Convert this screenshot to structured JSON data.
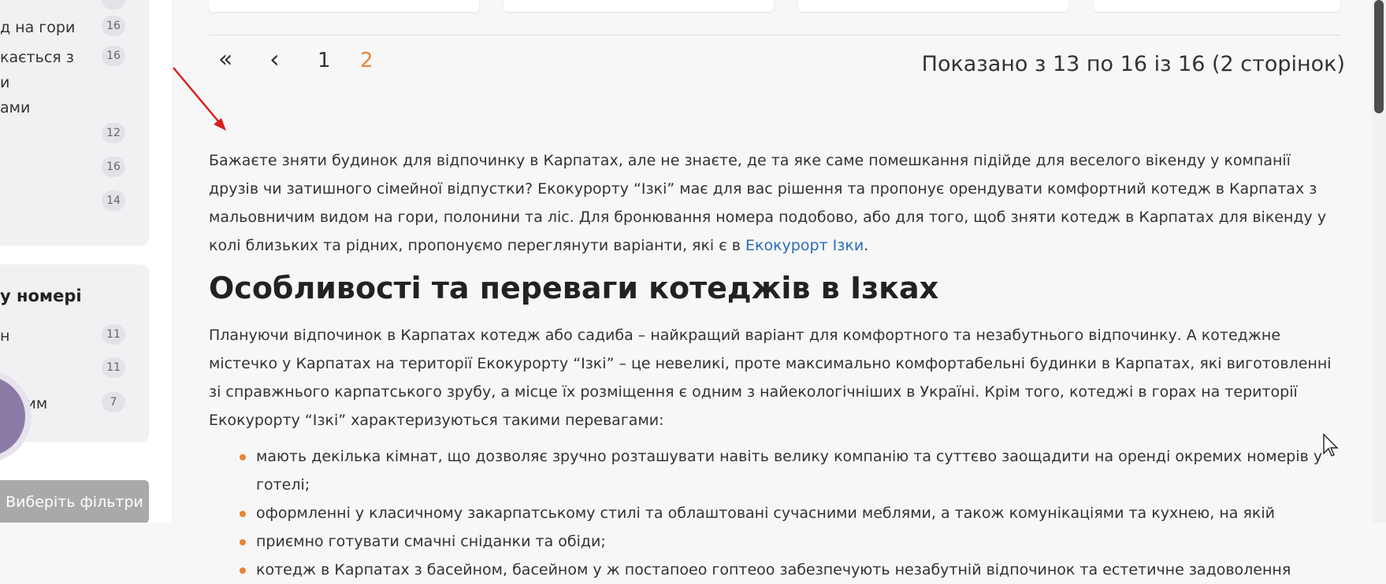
{
  "sidebar": {
    "box1_items": [
      {
        "label": "д на гори",
        "count": "16"
      },
      {
        "label": "кається з",
        "count": "16"
      },
      {
        "label": "и",
        "count": ""
      },
      {
        "label": "ами",
        "count": ""
      },
      {
        "label": "",
        "count": "12"
      },
      {
        "label": "",
        "count": "16"
      },
      {
        "label": "",
        "count": "14"
      }
    ],
    "box2_title": "у номері",
    "box2_items": [
      {
        "label": "н",
        "count": "11"
      },
      {
        "label": "",
        "count": "11"
      },
      {
        "label": "оским",
        "count": "7"
      }
    ],
    "filter_button": "Виберіть фільтри"
  },
  "pagination": {
    "first": "«",
    "prev": "‹",
    "pages": [
      "1",
      "2"
    ],
    "active_page": "2",
    "info": "Показано з 13 по 16 із 16 (2 сторінок)"
  },
  "content": {
    "intro_before_link": "Бажаєте зняти будинок для відпочинку в Карпатах, але не знаєте, де та яке саме помешкання підійде для веселого вікенду у компанії друзів чи затишного сімейної відпустки? Екокурорту “Ізкі” має для вас рішення та пропонує орендувати комфортний котедж в Карпатах з мальовничим видом на гори, полонини та ліс. Для бронювання номера подобово, або для того, щоб зняти котедж в Карпатах для вікенду у колі близьких та рідних, пропонуємо переглянути варіанти, які є в ",
    "intro_link": "Екокурорт Ізки",
    "intro_after_link": ".",
    "heading": "Особливості та переваги котеджів в Ізках",
    "para2": "Плануючи відпочинок в Карпатах котедж або садиба – найкращий варіант для комфортного та незабутнього відпочинку. А котеджне містечко у Карпатах на території Екокурорту “Ізкі” – це невеликі, проте максимально комфортабельні будинки в Карпатах, які виготовленні зі справжнього карпатського зрубу, а місце їх розміщення є одним з найекологічніших в Україні. Крім того, котеджі в горах на території Екокурорту “Ізкі” характеризуються такими перевагами:",
    "features": [
      "мають декілька кімнат, що дозволяє зручно розташувати навіть велику компанію та суттєво заощадити на оренді окремих номерів у готелі;",
      "оформленні у класичному закарпатському стилі та облаштовані сучасними меблями, а також комунікаціями та кухнею, на якій",
      "приємно готувати смачні сніданки та обіди;",
      "котедж в Карпатах з басейном, басейном у ж постапоео гоптеоо забезпечують незабутній відпочинок та естетичне задоволення"
    ]
  },
  "colors": {
    "accent": "#e88535",
    "link": "#2b6cb8",
    "annotation_arrow": "#d9201f"
  }
}
